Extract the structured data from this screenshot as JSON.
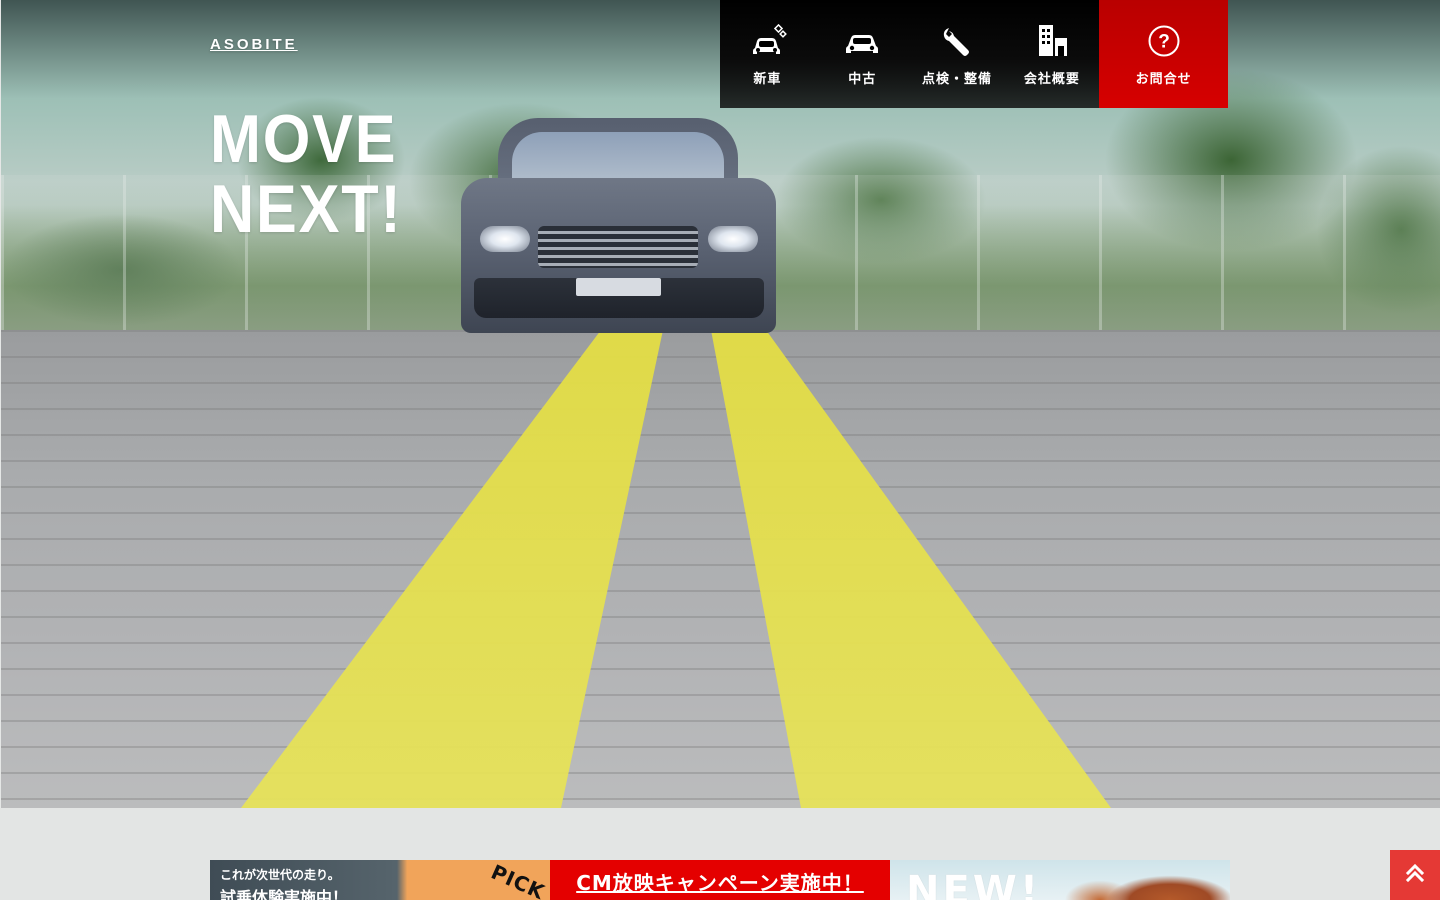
{
  "brand": {
    "logo_text": "ASOBITE"
  },
  "hero": {
    "tagline_line1": "MOVE",
    "tagline_line2": "NEXT!"
  },
  "nav": {
    "items": [
      {
        "label": "新車",
        "icon": "new-car-icon"
      },
      {
        "label": "中古",
        "icon": "used-car-icon"
      },
      {
        "label": "点検・整備",
        "icon": "wrench-icon"
      },
      {
        "label": "会社概要",
        "icon": "building-icon"
      },
      {
        "label": "お問合せ",
        "icon": "question-icon"
      }
    ]
  },
  "banners": {
    "test_drive": {
      "line1": "これが次世代の走り。",
      "line2": "試乗体験実施中！",
      "ribbon": "PICK"
    },
    "cm_campaign": {
      "text": "CM放映キャンペーン実施中！"
    },
    "new_model": {
      "text": "NEW!"
    }
  },
  "colors": {
    "accent_red": "#d60000",
    "nav_black": "#000000",
    "back_to_top": "#e53935"
  },
  "icons": {
    "back_to_top": "double-chevron-up-icon"
  }
}
